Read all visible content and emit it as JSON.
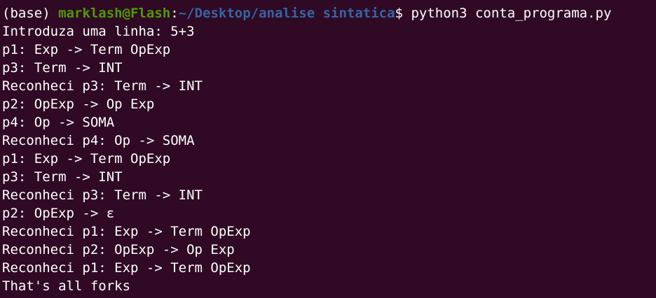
{
  "prompt": {
    "env": "(base) ",
    "user_host": "marklash@Flash",
    "colon": ":",
    "path": "~/Desktop/analise sintatica",
    "symbol": "$ ",
    "command": "python3 conta_programa.py"
  },
  "output": [
    "Introduza uma linha: 5+3",
    "p1: Exp -> Term OpExp",
    "p3: Term -> INT",
    "Reconheci p3: Term -> INT",
    "p2: OpExp -> Op Exp",
    "p4: Op -> SOMA",
    "Reconheci p4: Op -> SOMA",
    "p1: Exp -> Term OpExp",
    "p3: Term -> INT",
    "Reconheci p3: Term -> INT",
    "p2: OpExp -> ε",
    "Reconheci p1: Exp -> Term OpExp",
    "Reconheci p2: OpExp -> Op Exp",
    "Reconheci p1: Exp -> Term OpExp",
    "That's all forks"
  ],
  "colors": {
    "background": "#300a24",
    "text": "#ffffff",
    "user_host": "#4e9a06",
    "path": "#3465a4"
  }
}
